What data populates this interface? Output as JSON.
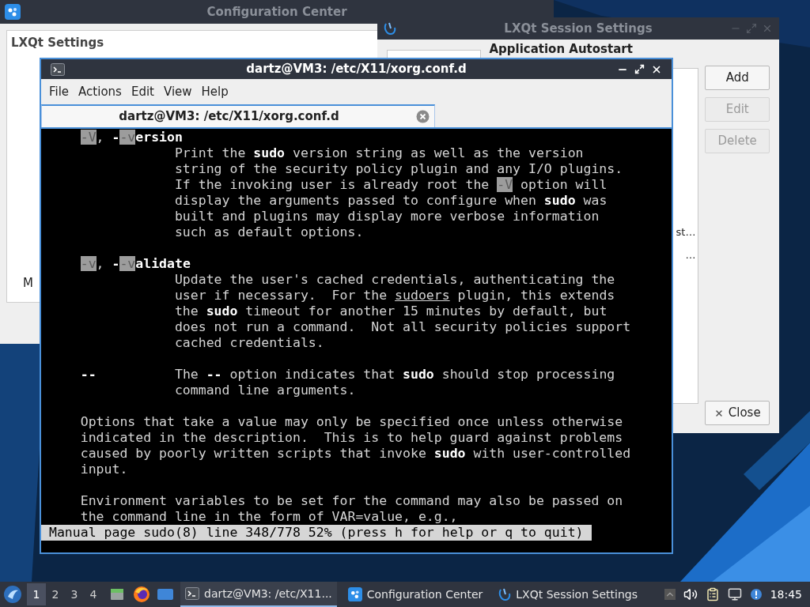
{
  "config_center": {
    "title": "Configuration Center",
    "panel_title": "LXQt Settings",
    "cut_labels": [
      "M"
    ]
  },
  "session_settings": {
    "title": "LXQt Session Settings",
    "heading": "Application Autostart",
    "cut_entries": [
      "st…",
      "…"
    ],
    "buttons": [
      {
        "label": "Add",
        "disabled": false
      },
      {
        "label": "Edit",
        "disabled": true
      },
      {
        "label": "Delete",
        "disabled": true
      }
    ],
    "close_button": {
      "label": "Close",
      "disabled": false
    }
  },
  "terminal": {
    "title": "dartz@VM3: /etc/X11/xorg.conf.d",
    "menu": [
      "File",
      "Actions",
      "Edit",
      "View",
      "Help"
    ],
    "tabs": [
      {
        "label": "dartz@VM3: /etc/X11/xorg.conf.d",
        "selected": true
      }
    ],
    "lines": [
      {
        "kind": "option",
        "segments": [
          {
            "text": "-V",
            "kind": "highlight"
          },
          {
            "text": ", ",
            "kind": "normal"
          },
          {
            "text": "-",
            "kind": "bold"
          },
          {
            "text": "-v",
            "kind": "highlight"
          },
          {
            "text": "ersion",
            "kind": "bold"
          }
        ]
      },
      {
        "kind": "description",
        "segments": [
          {
            "text": "Print the ",
            "kind": "normal"
          },
          {
            "text": "sudo",
            "kind": "bold"
          },
          {
            "text": " version string as well as the version",
            "kind": "normal"
          }
        ]
      },
      {
        "kind": "description",
        "segments": [
          {
            "text": "string of the security policy plugin and any I/O plugins.",
            "kind": "normal"
          }
        ]
      },
      {
        "kind": "description",
        "segments": [
          {
            "text": "If the invoking user is already root the ",
            "kind": "normal"
          },
          {
            "text": "-V",
            "kind": "highlight"
          },
          {
            "text": " option will",
            "kind": "normal"
          }
        ]
      },
      {
        "kind": "description",
        "segments": [
          {
            "text": "display the arguments passed to configure when ",
            "kind": "normal"
          },
          {
            "text": "sudo",
            "kind": "bold"
          },
          {
            "text": " was",
            "kind": "normal"
          }
        ]
      },
      {
        "kind": "description",
        "segments": [
          {
            "text": "built and plugins may display more verbose information",
            "kind": "normal"
          }
        ]
      },
      {
        "kind": "description",
        "segments": [
          {
            "text": "such as default options.",
            "kind": "normal"
          }
        ]
      },
      {
        "kind": "blank"
      },
      {
        "kind": "option",
        "segments": [
          {
            "text": "-v",
            "kind": "highlight"
          },
          {
            "text": ", ",
            "kind": "normal"
          },
          {
            "text": "-",
            "kind": "bold"
          },
          {
            "text": "-v",
            "kind": "highlight"
          },
          {
            "text": "alidate",
            "kind": "bold"
          }
        ]
      },
      {
        "kind": "description",
        "segments": [
          {
            "text": "Update the user's cached credentials, authenticating the",
            "kind": "normal"
          }
        ]
      },
      {
        "kind": "description",
        "segments": [
          {
            "text": "user if necessary.  For the ",
            "kind": "normal"
          },
          {
            "text": "sudoers",
            "kind": "underline"
          },
          {
            "text": " plugin, this extends",
            "kind": "normal"
          }
        ]
      },
      {
        "kind": "description",
        "segments": [
          {
            "text": "the ",
            "kind": "normal"
          },
          {
            "text": "sudo",
            "kind": "bold"
          },
          {
            "text": " timeout for another 15 minutes by default, but",
            "kind": "normal"
          }
        ]
      },
      {
        "kind": "description",
        "segments": [
          {
            "text": "does not run a command.  Not all security policies support",
            "kind": "normal"
          }
        ]
      },
      {
        "kind": "description",
        "segments": [
          {
            "text": "cached credentials.",
            "kind": "normal"
          }
        ]
      },
      {
        "kind": "blank"
      },
      {
        "kind": "option",
        "segments": [
          {
            "text": "--",
            "kind": "bold"
          },
          {
            "text": "          The ",
            "kind": "normal"
          },
          {
            "text": "--",
            "kind": "bold"
          },
          {
            "text": " option indicates that ",
            "kind": "normal"
          },
          {
            "text": "sudo",
            "kind": "bold"
          },
          {
            "text": " should stop processing",
            "kind": "normal"
          }
        ]
      },
      {
        "kind": "description",
        "segments": [
          {
            "text": "command line arguments.",
            "kind": "normal"
          }
        ]
      },
      {
        "kind": "blank"
      },
      {
        "kind": "paragraph",
        "segments": [
          {
            "text": "Options that take a value may only be specified once unless otherwise",
            "kind": "normal"
          }
        ]
      },
      {
        "kind": "paragraph",
        "segments": [
          {
            "text": "indicated in the description.  This is to help guard against problems",
            "kind": "normal"
          }
        ]
      },
      {
        "kind": "paragraph",
        "segments": [
          {
            "text": "caused by poorly written scripts that invoke ",
            "kind": "normal"
          },
          {
            "text": "sudo",
            "kind": "bold"
          },
          {
            "text": " with user-controlled",
            "kind": "normal"
          }
        ]
      },
      {
        "kind": "paragraph",
        "segments": [
          {
            "text": "input.",
            "kind": "normal"
          }
        ]
      },
      {
        "kind": "blank"
      },
      {
        "kind": "paragraph",
        "segments": [
          {
            "text": "Environment variables to be set for the command may also be passed on",
            "kind": "normal"
          }
        ]
      },
      {
        "kind": "paragraph",
        "segments": [
          {
            "text": "the command line in the form of VAR=value, e.g.,",
            "kind": "normal"
          }
        ]
      }
    ],
    "status_line": "Manual page sudo(8) line 348/778 52% (press h for help or q to quit)"
  },
  "taskbar": {
    "desktops": [
      {
        "label": "1",
        "selected": true
      },
      {
        "label": "2",
        "selected": false
      },
      {
        "label": "3",
        "selected": false
      },
      {
        "label": "4",
        "selected": false
      }
    ],
    "tasks": [
      {
        "kind": "terminal",
        "label": "dartz@VM3: /etc/X11...",
        "selected": true
      },
      {
        "kind": "config",
        "label": "Configuration Center",
        "selected": false
      },
      {
        "kind": "session",
        "label": "LXQt Session Settings",
        "selected": false
      }
    ],
    "clock": "18:45"
  }
}
